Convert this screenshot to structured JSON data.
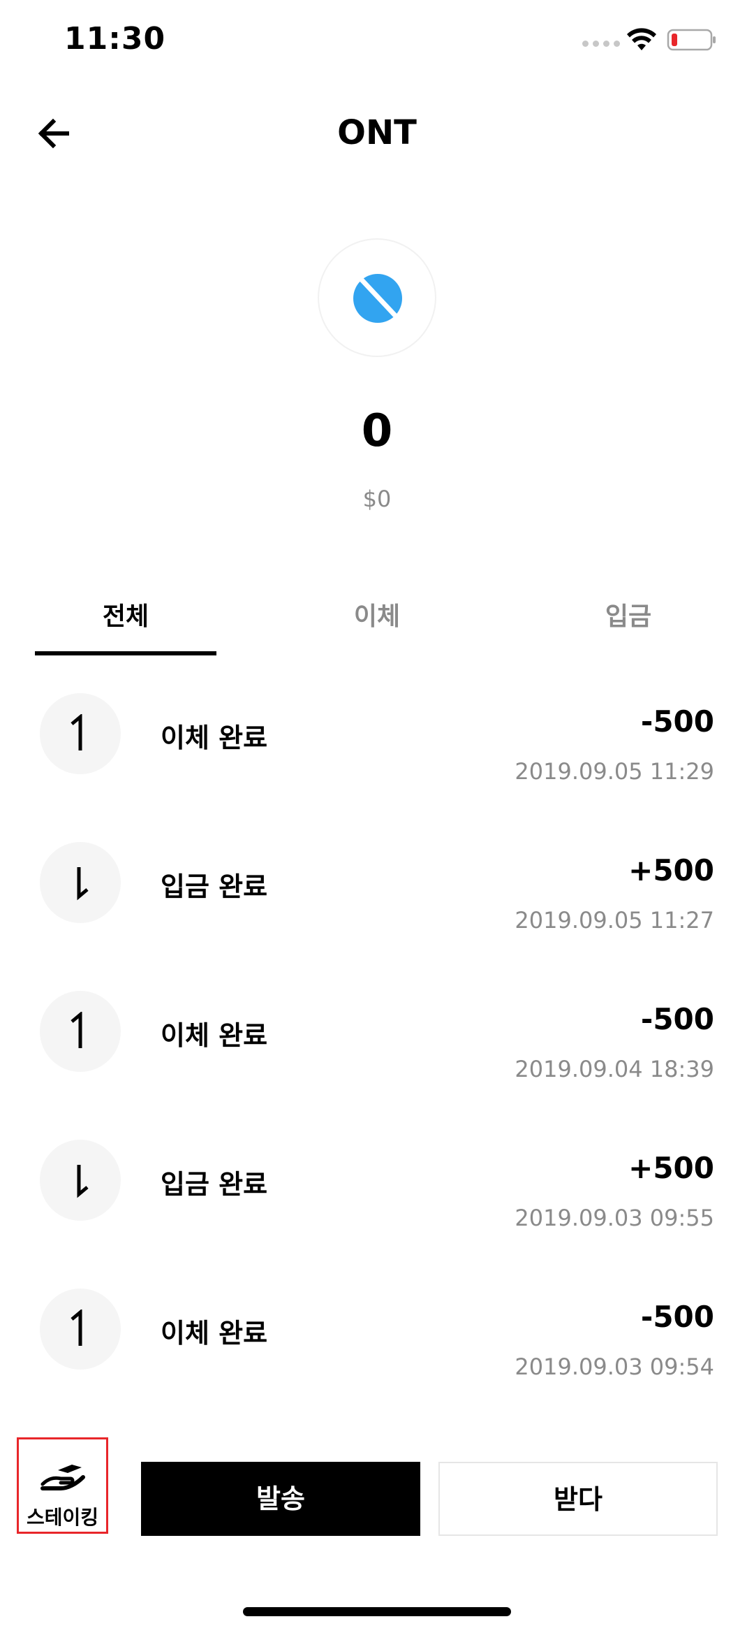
{
  "status_bar": {
    "time": "11:30",
    "icons": [
      "signal-icon",
      "wifi-icon",
      "battery-icon"
    ],
    "battery_color": "#e8262a"
  },
  "header": {
    "title": "ONT",
    "back_icon": "arrow-left-icon"
  },
  "coin": {
    "logo_icon": "ont-logo-icon",
    "logo_color": "#32a4f0",
    "balance": "0",
    "balance_usd": "$0"
  },
  "tabs": [
    {
      "label": "전체",
      "active": true
    },
    {
      "label": "이체",
      "active": false
    },
    {
      "label": "입금",
      "active": false
    }
  ],
  "transactions": [
    {
      "direction": "out",
      "icon": "arrow-up-icon",
      "label": "이체 완료",
      "amount": "-500",
      "date": "2019.09.05 11:29"
    },
    {
      "direction": "in",
      "icon": "arrow-down-icon",
      "label": "입금 완료",
      "amount": "+500",
      "date": "2019.09.05 11:27"
    },
    {
      "direction": "out",
      "icon": "arrow-up-icon",
      "label": "이체 완료",
      "amount": "-500",
      "date": "2019.09.04 18:39"
    },
    {
      "direction": "in",
      "icon": "arrow-down-icon",
      "label": "입금 완료",
      "amount": "+500",
      "date": "2019.09.03 09:55"
    },
    {
      "direction": "out",
      "icon": "arrow-up-icon",
      "label": "이체 완료",
      "amount": "-500",
      "date": "2019.09.03 09:54"
    }
  ],
  "actions": {
    "staking_label": "스테이킹",
    "staking_icon": "staking-hand-icon",
    "send_label": "발송",
    "receive_label": "받다",
    "highlight_color": "#e8262a"
  }
}
